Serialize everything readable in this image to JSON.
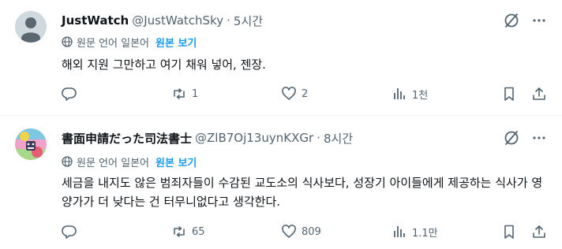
{
  "colors": {
    "text_primary": "#0f1419",
    "text_secondary": "#536471",
    "accent": "#1d9bf0",
    "divider": "#eff3f4"
  },
  "posts": [
    {
      "display_name": "JustWatch",
      "handle": "@JustWatchSky",
      "separator": "·",
      "time": "5시간",
      "avatar_icon": "default-avatar-icon",
      "translate": {
        "original_language": "원문 언어 일본어",
        "show_original": "원본 보기"
      },
      "text": "해외 지원 그만하고 여기 채워 넣어, 젠장.",
      "actions": {
        "replies": "",
        "retweets": "1",
        "likes": "2",
        "views": "1천"
      }
    },
    {
      "display_name": "書面申請だった司法書士",
      "handle": "@ZlB7Oj13uynKXGr",
      "separator": "·",
      "time": "8시간",
      "avatar_icon": "user-avatar-image",
      "translate": {
        "original_language": "원문 언어 일본어",
        "show_original": "원본 보기"
      },
      "text": "세금을 내지도 않은 범죄자들이 수감된 교도소의 식사보다, 성장기 아이들에게 제공하는 식사가 영양가가 더 낮다는 건 터무니없다고 생각한다.",
      "actions": {
        "replies": "",
        "retweets": "65",
        "likes": "809",
        "views": "1.1만"
      }
    }
  ]
}
